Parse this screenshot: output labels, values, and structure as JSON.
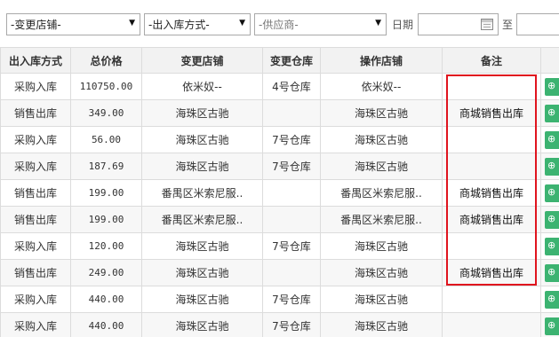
{
  "filters": {
    "store_select": "-变更店铺-",
    "io_type_select": "-出入库方式-",
    "supplier_select": "-供应商-",
    "date_label": "日期",
    "to_label": "至"
  },
  "table": {
    "headers": [
      "出入库方式",
      "总价格",
      "变更店铺",
      "变更仓库",
      "操作店铺",
      "备注",
      ""
    ],
    "rows": [
      {
        "type": "采购入库",
        "price": "110750.00",
        "store": "依米奴--",
        "warehouse": "4号仓库",
        "op_store": "依米奴--",
        "remark": ""
      },
      {
        "type": "销售出库",
        "price": "349.00",
        "store": "海珠区古驰",
        "warehouse": "",
        "op_store": "海珠区古驰",
        "remark": "商城销售出库"
      },
      {
        "type": "采购入库",
        "price": "56.00",
        "store": "海珠区古驰",
        "warehouse": "7号仓库",
        "op_store": "海珠区古驰",
        "remark": ""
      },
      {
        "type": "采购入库",
        "price": "187.69",
        "store": "海珠区古驰",
        "warehouse": "7号仓库",
        "op_store": "海珠区古驰",
        "remark": ""
      },
      {
        "type": "销售出库",
        "price": "199.00",
        "store": "番禺区米索尼服..",
        "warehouse": "",
        "op_store": "番禺区米索尼服..",
        "remark": "商城销售出库"
      },
      {
        "type": "销售出库",
        "price": "199.00",
        "store": "番禺区米索尼服..",
        "warehouse": "",
        "op_store": "番禺区米索尼服..",
        "remark": "商城销售出库"
      },
      {
        "type": "采购入库",
        "price": "120.00",
        "store": "海珠区古驰",
        "warehouse": "7号仓库",
        "op_store": "海珠区古驰",
        "remark": ""
      },
      {
        "type": "销售出库",
        "price": "249.00",
        "store": "海珠区古驰",
        "warehouse": "",
        "op_store": "海珠区古驰",
        "remark": "商城销售出库"
      },
      {
        "type": "采购入库",
        "price": "440.00",
        "store": "海珠区古驰",
        "warehouse": "7号仓库",
        "op_store": "海珠区古驰",
        "remark": ""
      },
      {
        "type": "采购入库",
        "price": "440.00",
        "store": "海珠区古驰",
        "warehouse": "7号仓库",
        "op_store": "海珠区古驰",
        "remark": ""
      }
    ]
  },
  "colors": {
    "highlight": "#e0141e",
    "action_button": "#3cb371",
    "header_bg": "#f2f2f2"
  }
}
